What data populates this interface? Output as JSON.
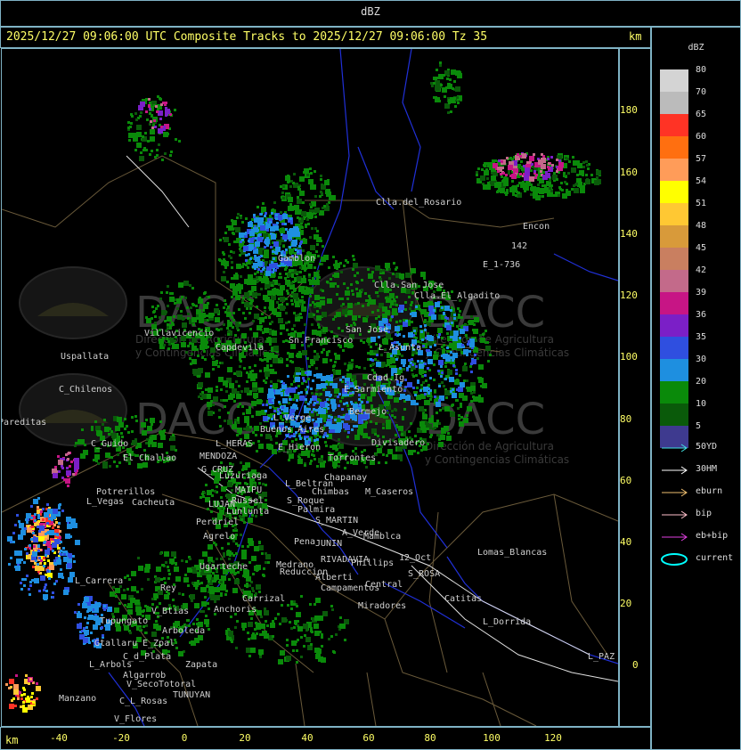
{
  "header": {
    "title": "dBZ"
  },
  "subtitle": "2025/12/27 09:06:00 UTC Composite Tracks to 2025/12/27 09:06:00 Tz 35",
  "axis_unit": "km",
  "y_ticks": [
    "180",
    "160",
    "140",
    "120",
    "100",
    "80",
    "60",
    "40",
    "20",
    "0"
  ],
  "x_ticks": [
    "-40",
    "-20",
    "0",
    "20",
    "40",
    "60",
    "80",
    "100",
    "120"
  ],
  "legend": {
    "title": "dBZ",
    "scale": [
      {
        "value": "80",
        "color": "#d4d4d4"
      },
      {
        "value": "70",
        "color": "#bbbbbb"
      },
      {
        "value": "65",
        "color": "#ff3325"
      },
      {
        "value": "60",
        "color": "#ff6f10"
      },
      {
        "value": "57",
        "color": "#ff9c59"
      },
      {
        "value": "54",
        "color": "#ffff00"
      },
      {
        "value": "51",
        "color": "#ffc833"
      },
      {
        "value": "48",
        "color": "#d89a3a"
      },
      {
        "value": "45",
        "color": "#c97f60"
      },
      {
        "value": "42",
        "color": "#c36a8a"
      },
      {
        "value": "39",
        "color": "#c71585"
      },
      {
        "value": "36",
        "color": "#7b1fc7"
      },
      {
        "value": "35",
        "color": "#2f4fe0"
      },
      {
        "value": "30",
        "color": "#1e8fe0"
      },
      {
        "value": "20",
        "color": "#0a8a0a"
      },
      {
        "value": "10",
        "color": "#0a5a0a"
      },
      {
        "value": "5",
        "color": "#3e3a8f"
      }
    ],
    "tracks": [
      {
        "label": "50YD",
        "color": "#40e0e0"
      },
      {
        "label": "30HM",
        "color": "#ffffff"
      },
      {
        "label": "eburn",
        "color": "#f0c070"
      },
      {
        "label": "bip",
        "color": "#ffc0cb"
      },
      {
        "label": "eb+bip",
        "color": "#e040e0"
      },
      {
        "label": "current",
        "color": "#00ffff"
      }
    ]
  },
  "watermark": {
    "logo": "DACC",
    "line1": "Dirección de Agricultura",
    "line2": "y Contingencias Climáticas"
  },
  "places": [
    "Clla.del_Rosario",
    "Encon",
    "142",
    "E_1-736",
    "Gamblon",
    "Clla.San Jose",
    "Clla.El_Algadito",
    "Villavicencio",
    "Capdevila",
    "Sn.Francisco",
    "San Jose",
    "L_Asunta",
    "Uspallata",
    "C_Chilenos",
    "E_Sarmiento",
    "Cdad.Ig",
    "Pareditas",
    "L_Verge",
    "Bermejo",
    "Buenos Aires",
    "C_Guido",
    "El Challao",
    "L_HERAS",
    "E_Hieron",
    "Divisadero",
    "MENDOZA",
    "G_CRUZ",
    "Luzuriaga",
    "Torrontes",
    "Chapanay",
    "L_Beltran",
    "Chimbas",
    "M_Caseros",
    "Potrerillos",
    "L_Vegas",
    "Cacheuta",
    "MAIPU",
    "Russel",
    "LUJAN",
    "Lunlunta",
    "S_Roque",
    "Palmira",
    "S_MARTIN",
    "Perdriel",
    "Agrelo",
    "Pena",
    "JUNIN",
    "A_Verde",
    "Mamblca",
    "Lomas_Blancas",
    "L_Carrera",
    "Ugarteche",
    "Medrano",
    "RIVADAVIA",
    "Phillips",
    "12_Oct",
    "S_ROSA",
    "Reduccion",
    "Alberti",
    "Campamentos",
    "Central",
    "Catitas",
    "Tupungato",
    "Rey",
    "V_Btias",
    "Anchoris",
    "Carrizal",
    "L_Dorrida",
    "Miradores",
    "Arboleda",
    "E_Zpal",
    "Gtallaru",
    "C_d_Plata",
    "L_Arbols",
    "Algarrob",
    "Zapata",
    "V_Seco",
    "Totoral",
    "TUNUYAN",
    "Manzano",
    "C_L_Rosas",
    "V_Flores",
    "L_PAZ"
  ]
}
